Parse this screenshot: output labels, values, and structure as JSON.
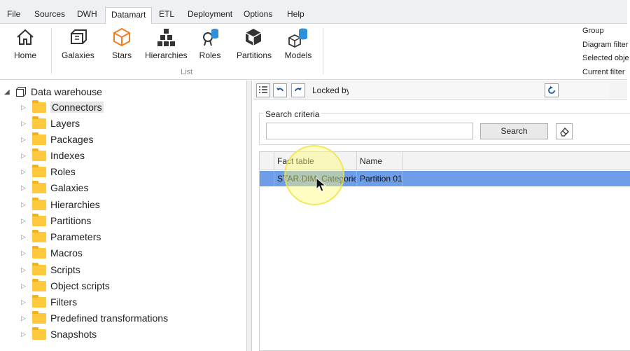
{
  "menu": [
    "File",
    "Sources",
    "DWH",
    "Datamart",
    "ETL",
    "Deployment",
    "Options",
    "Help"
  ],
  "menu_active": "Datamart",
  "ribbon": {
    "home": "Home",
    "galaxies": "Galaxies",
    "stars": "Stars",
    "hierarchies": "Hierarchies",
    "roles": "Roles",
    "partitions": "Partitions",
    "models": "Models",
    "group_label": "List",
    "right_items": [
      "Group",
      "Diagram filter",
      "Selected obje",
      "Current filter"
    ]
  },
  "tree": {
    "root": "Data warehouse",
    "items": [
      "Connectors",
      "Layers",
      "Packages",
      "Indexes",
      "Roles",
      "Galaxies",
      "Hierarchies",
      "Partitions",
      "Parameters",
      "Macros",
      "Scripts",
      "Object scripts",
      "Filters",
      "Predefined transformations",
      "Snapshots"
    ]
  },
  "toolbar": {
    "locked_by_label": "Locked by",
    "locked_by_value": ""
  },
  "search": {
    "legend": "Search criteria",
    "value": "",
    "button": "Search"
  },
  "grid": {
    "columns": [
      "Fact table",
      "Name"
    ],
    "rows": [
      {
        "fact_table": "STAR.DIM_Categories",
        "name": "Partition 01",
        "selected": true
      }
    ]
  },
  "colors": {
    "selection": "#6f9ee8",
    "folder": "#ffc83d",
    "accent_orange": "#f07f22",
    "accent_blue": "#2f8fd8"
  },
  "icons": [
    "home-icon",
    "galaxies-icon",
    "stars-icon",
    "hierarchies-icon",
    "roles-icon",
    "partitions-icon",
    "models-icon",
    "folder-icon",
    "eraser-icon",
    "refresh-icon",
    "undo-icon",
    "redo-icon",
    "list-icon"
  ]
}
